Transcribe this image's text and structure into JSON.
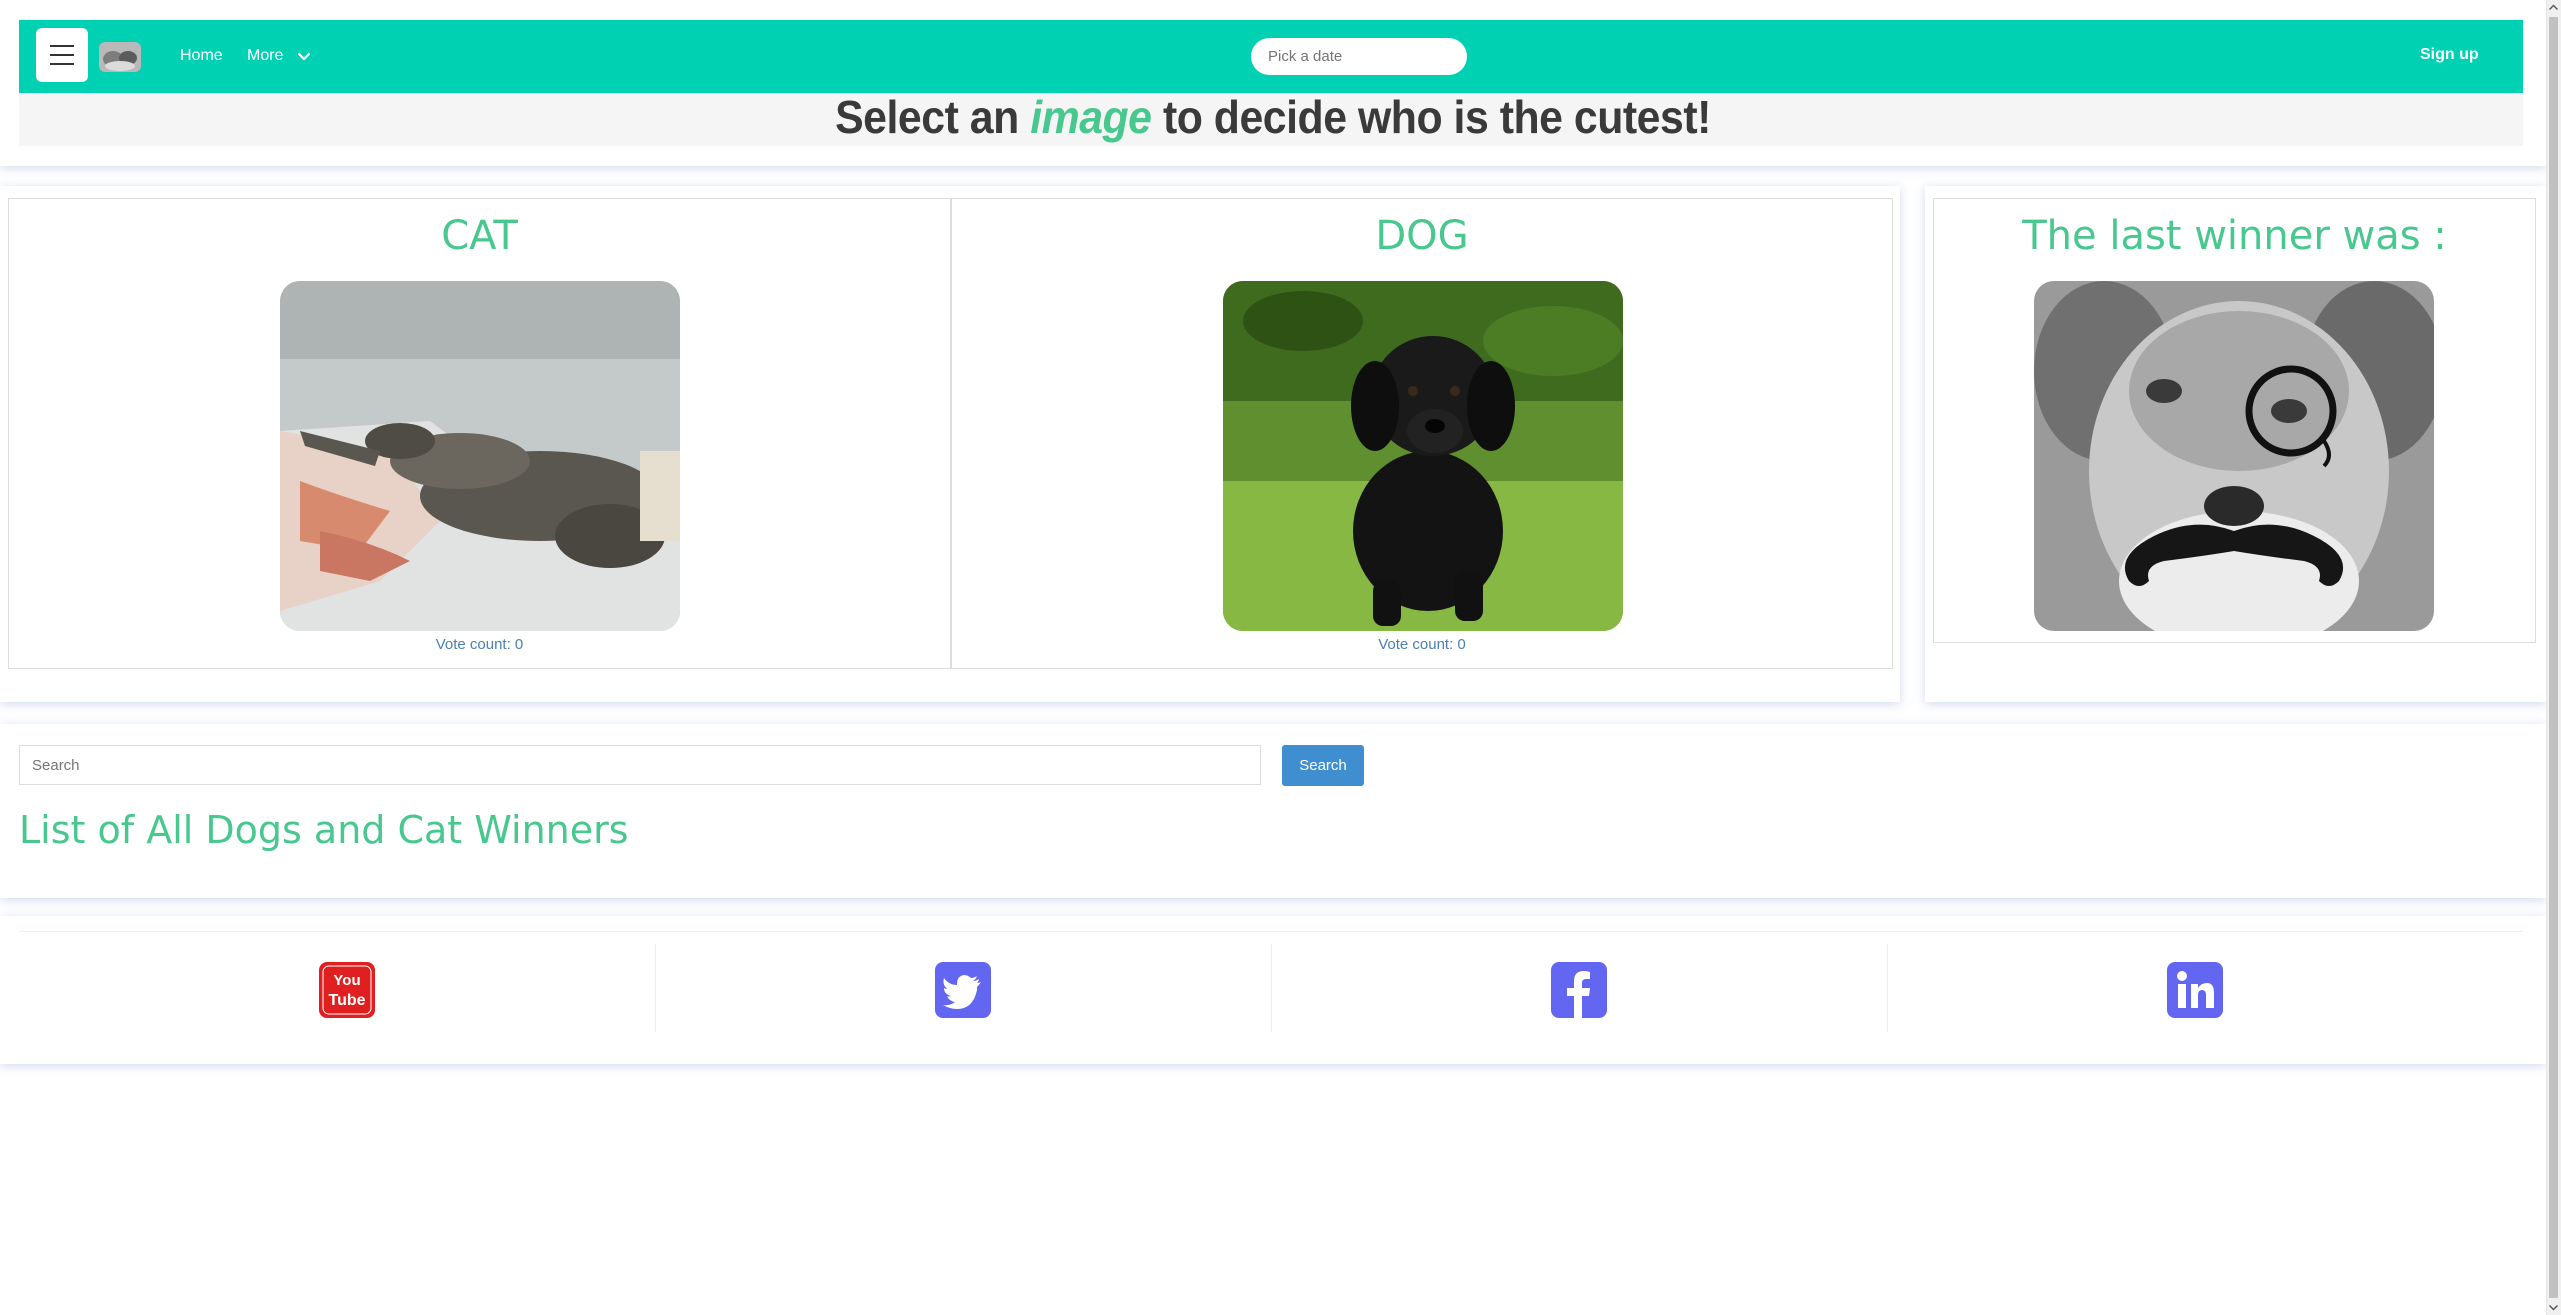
{
  "nav": {
    "home": "Home",
    "more": "More",
    "date_placeholder": "Pick a date",
    "signup": "Sign up"
  },
  "headline": {
    "before": "Select an",
    "emphasis": "image",
    "after": "to decide who is the cutest!"
  },
  "vote": {
    "cat": {
      "title": "CAT",
      "vote_label": "Vote count: 0"
    },
    "dog": {
      "title": "DOG",
      "vote_label": "Vote count: 0"
    }
  },
  "winner": {
    "title": "The last winner was :"
  },
  "search": {
    "placeholder": "Search",
    "button": "Search",
    "list_title": "List of All Dogs and Cat Winners"
  },
  "social": [
    {
      "icon": "youtube-icon",
      "color": "#e02020",
      "top": "You",
      "bottom": "Tube"
    },
    {
      "icon": "twitter-icon",
      "color": "#6366f1"
    },
    {
      "icon": "facebook-icon",
      "color": "#6366f1"
    },
    {
      "icon": "linkedin-icon",
      "color": "#6366f1"
    }
  ],
  "colors": {
    "navbar": "#00d1b2",
    "accent_green": "#48c78e",
    "search_button": "#3e8ed0",
    "vote_text": "#4a7fb5"
  }
}
